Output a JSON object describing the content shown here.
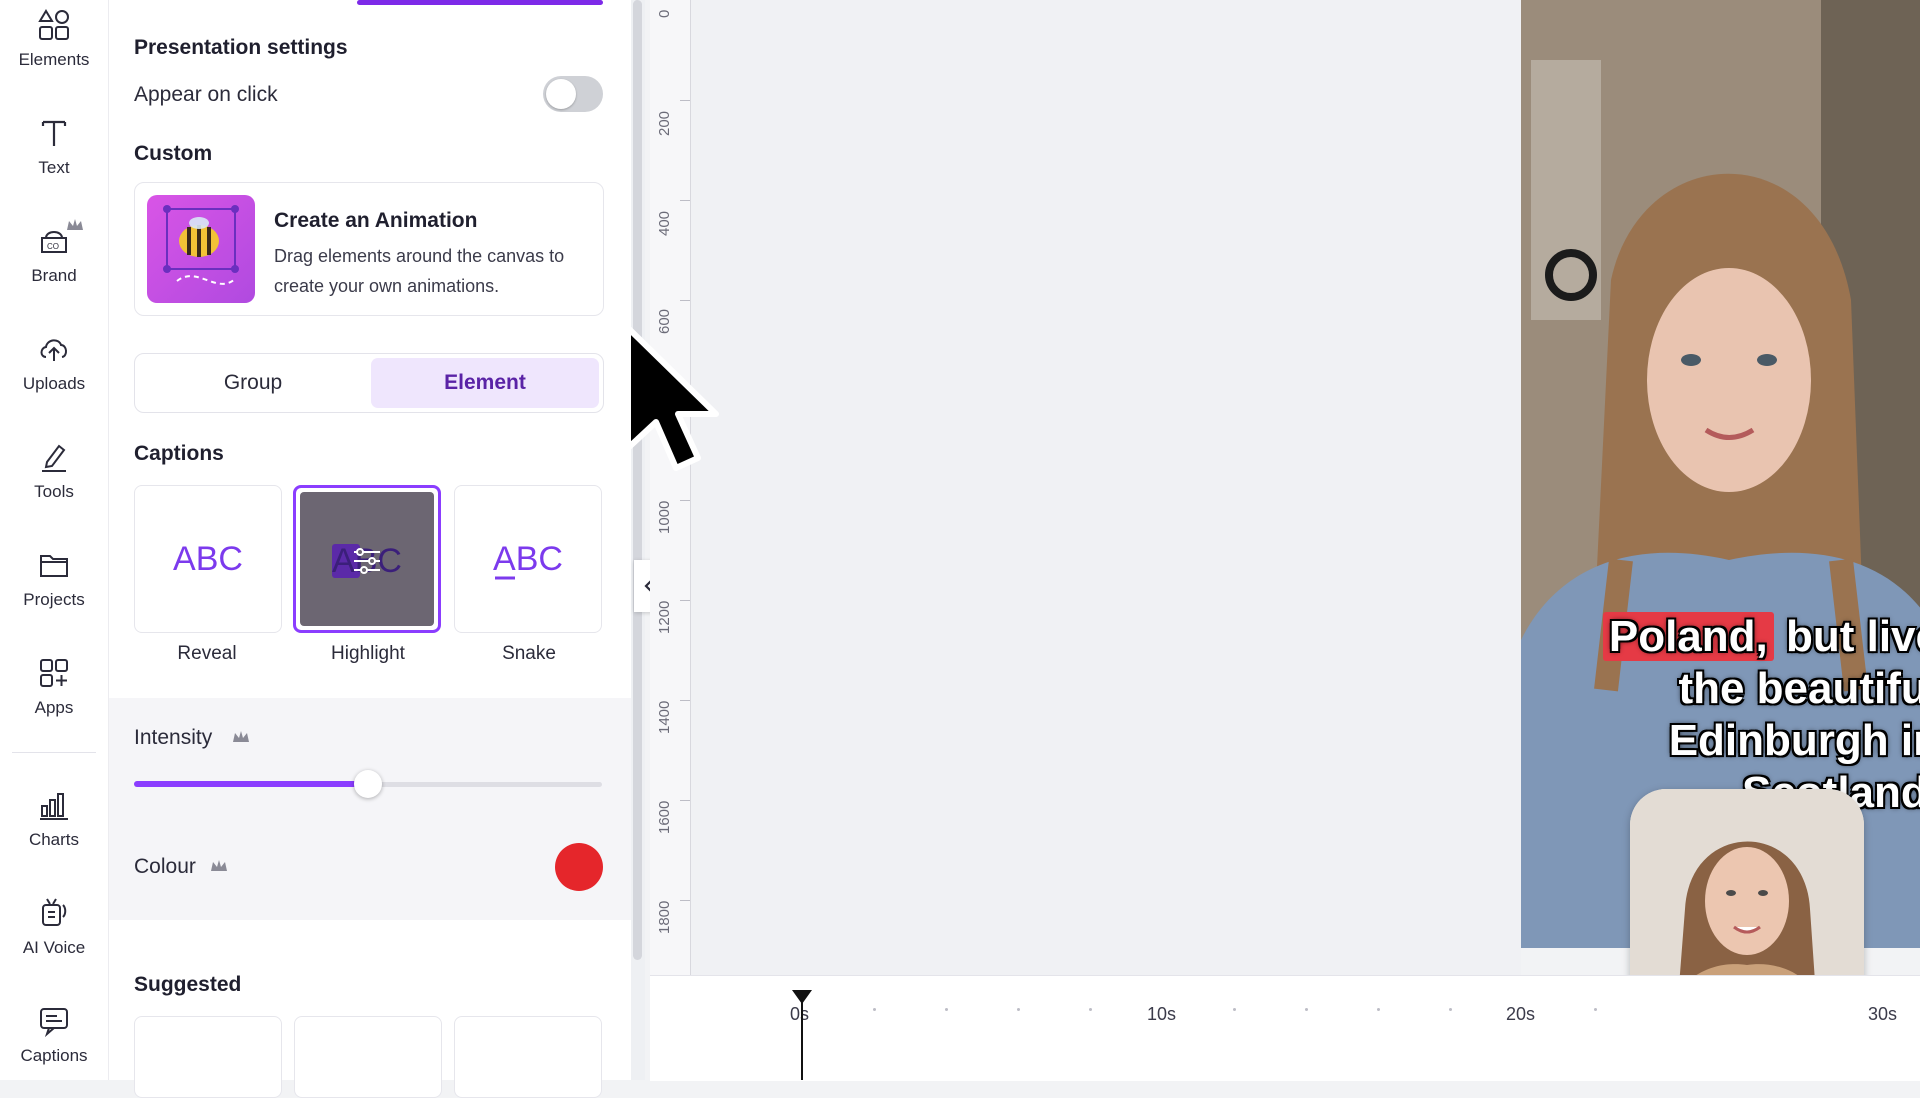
{
  "sidebar": {
    "items": [
      {
        "label": "Elements",
        "icon": "elements-icon"
      },
      {
        "label": "Text",
        "icon": "text-icon"
      },
      {
        "label": "Brand",
        "icon": "brand-icon"
      },
      {
        "label": "Uploads",
        "icon": "uploads-icon"
      },
      {
        "label": "Tools",
        "icon": "tools-icon"
      },
      {
        "label": "Projects",
        "icon": "projects-icon"
      },
      {
        "label": "Apps",
        "icon": "apps-icon"
      },
      {
        "label": "Charts",
        "icon": "charts-icon"
      },
      {
        "label": "AI Voice",
        "icon": "ai-voice-icon"
      },
      {
        "label": "Captions",
        "icon": "captions-icon"
      }
    ]
  },
  "panel": {
    "presentation_title": "Presentation settings",
    "appear_on_click": "Appear on click",
    "appear_on_click_on": false,
    "custom_title": "Custom",
    "animation_card": {
      "title": "Create an Animation",
      "description": "Drag elements around the canvas to create your own animations."
    },
    "segmented": {
      "group": "Group",
      "element": "Element",
      "selected": "Element"
    },
    "captions_title": "Captions",
    "captions": [
      {
        "label": "Reveal",
        "preview": "ABC"
      },
      {
        "label": "Highlight",
        "preview": "ABC"
      },
      {
        "label": "Snake",
        "preview": "ABC"
      }
    ],
    "selected_caption": "Highlight",
    "intensity_label": "Intensity",
    "intensity_value": 0.5,
    "colour_label": "Colour",
    "colour_value": "#e5262b",
    "suggested_title": "Suggested"
  },
  "ruler": [
    "0",
    "200",
    "400",
    "600",
    "1000",
    "1200",
    "1400",
    "1600",
    "1800"
  ],
  "video": {
    "subtitle_lines": [
      "Poland, but live",
      "the beautiful",
      "Edinburgh in",
      "Scotland."
    ],
    "highlight_word": "Poland,"
  },
  "timeline": {
    "labels": [
      "0s",
      "10s",
      "20s",
      "30s"
    ]
  },
  "colors": {
    "accent": "#8b3dff",
    "highlight": "#e53a45"
  }
}
